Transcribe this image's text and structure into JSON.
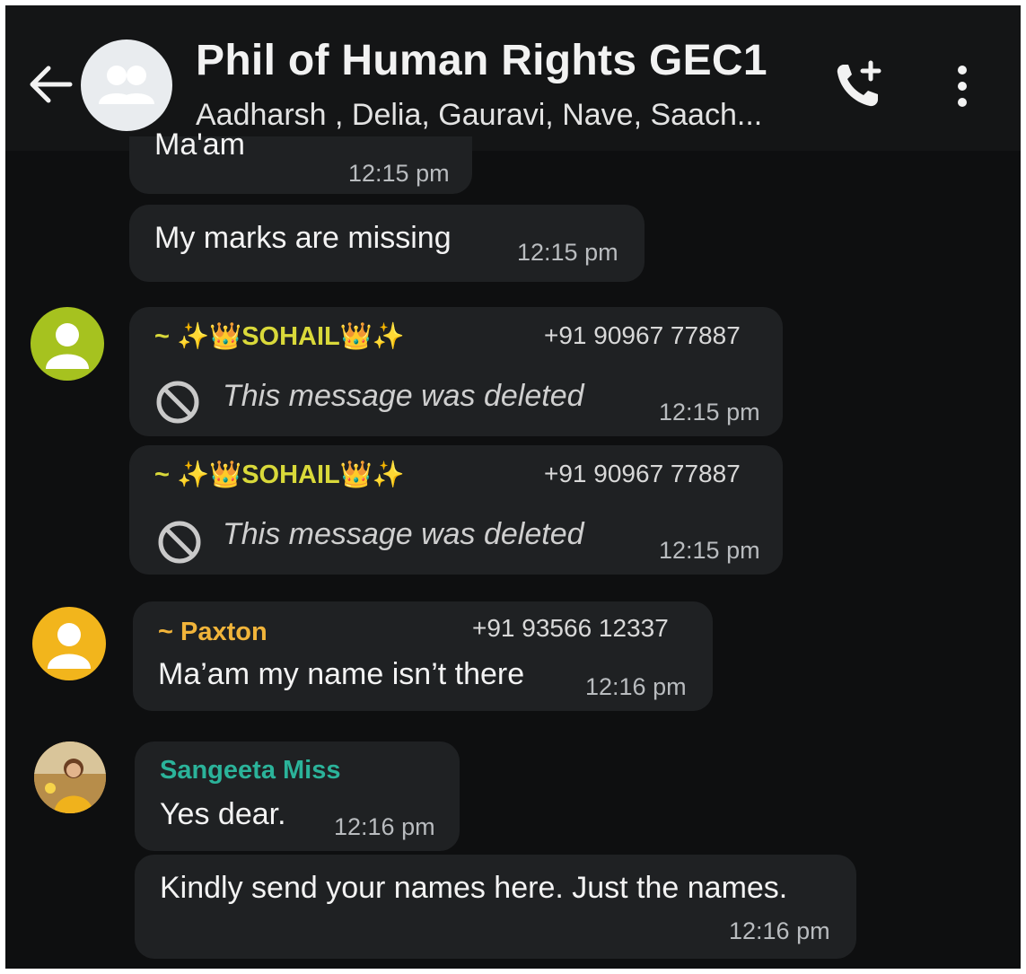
{
  "header": {
    "title": "Phil of Human Rights GEC1",
    "members": "Aadharsh , Delia, Gauravi, Nave, Saach..."
  },
  "messages": [
    {
      "text": "Ma'am",
      "time": "12:15 pm"
    },
    {
      "text": "My marks are missing",
      "time": "12:15 pm"
    },
    {
      "sender": "~ ✨👑SOHAIL👑✨",
      "phone": "+91 90967 77887",
      "deleted_text": "This message was deleted",
      "time": "12:15 pm"
    },
    {
      "sender": "~ ✨👑SOHAIL👑✨",
      "phone": "+91 90967 77887",
      "deleted_text": "This message was deleted",
      "time": "12:15 pm"
    },
    {
      "sender": "~ Paxton",
      "phone": "+91 93566 12337",
      "text": "Ma’am my name isn’t there",
      "time": "12:16 pm"
    },
    {
      "sender": "Sangeeta Miss",
      "text": "Yes dear.",
      "time": "12:16 pm"
    },
    {
      "text": "Kindly send your names here. Just the names.",
      "time": "12:16 pm"
    }
  ],
  "colors": {
    "background": "#0e0f10",
    "bubble": "#1f2123",
    "sohail": "#d9d93a",
    "paxton": "#f1b43a",
    "sangeeta": "#2bb39a",
    "sohail_avatar": "#a6c21f",
    "paxton_avatar": "#f2b51c"
  },
  "icons": [
    "back-arrow-icon",
    "group-avatar-icon",
    "add-call-icon",
    "more-vert-icon",
    "deleted-icon",
    "person-icon"
  ]
}
